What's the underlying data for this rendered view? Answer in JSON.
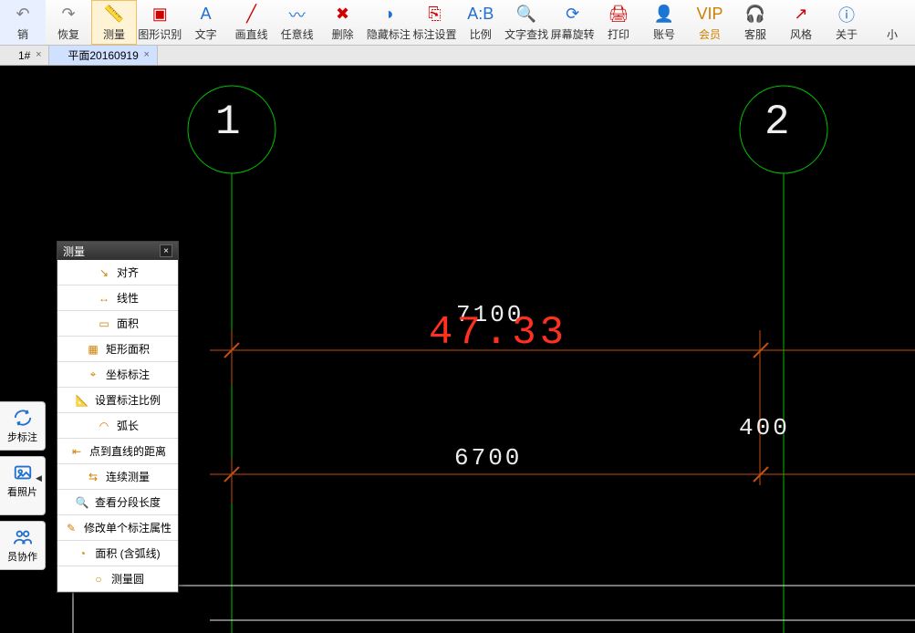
{
  "toolbar": {
    "items": [
      {
        "label": "销",
        "icon": "↶",
        "color": "#808080"
      },
      {
        "label": "恢复",
        "icon": "↷",
        "color": "#808080"
      },
      {
        "label": "测量",
        "icon": "📏",
        "color": "#2070d0",
        "active": true
      },
      {
        "label": "图形识别",
        "icon": "▣",
        "color": "#d00000"
      },
      {
        "label": "文字",
        "icon": "A",
        "color": "#2070d0"
      },
      {
        "label": "画直线",
        "icon": "╱",
        "color": "#d00000"
      },
      {
        "label": "任意线",
        "icon": "〰",
        "color": "#2070d0"
      },
      {
        "label": "删除",
        "icon": "✖",
        "color": "#d00000"
      },
      {
        "label": "隐藏标注",
        "icon": "◑",
        "color": "#2070d0"
      },
      {
        "label": "标注设置",
        "icon": "⎘",
        "color": "#d00000"
      },
      {
        "label": "比例",
        "icon": "A:B",
        "color": "#2070d0"
      },
      {
        "label": "文字查找",
        "icon": "🔍",
        "color": "#d00000"
      },
      {
        "label": "屏幕旋转",
        "icon": "⟳",
        "color": "#2070d0"
      },
      {
        "label": "打印",
        "icon": "🖨",
        "color": "#d00000"
      },
      {
        "label": "账号",
        "icon": "👤",
        "color": "#2070d0"
      },
      {
        "label": "会员",
        "icon": "VIP",
        "color": "#d08000",
        "vip": true
      },
      {
        "label": "客服",
        "icon": "🎧",
        "color": "#2070d0"
      },
      {
        "label": "风格",
        "icon": "↗",
        "color": "#d00000"
      },
      {
        "label": "关于",
        "icon": "ⓘ",
        "color": "#2070d0"
      },
      {
        "label": "小",
        "icon": "",
        "color": "#333"
      }
    ]
  },
  "tabs": {
    "items": [
      {
        "label": "1#",
        "active": false
      },
      {
        "label": "平面20160919",
        "active": true
      }
    ]
  },
  "side": {
    "items": [
      {
        "label": "步标注",
        "icon": "sync"
      },
      {
        "label": "看照片",
        "icon": "photo"
      },
      {
        "label": "员协作",
        "icon": "team"
      }
    ]
  },
  "panel": {
    "title": "测量",
    "items": [
      {
        "label": "对齐",
        "icon": "↘"
      },
      {
        "label": "线性",
        "icon": "↔"
      },
      {
        "label": "面积",
        "icon": "▭"
      },
      {
        "label": "矩形面积",
        "icon": "▦"
      },
      {
        "label": "坐标标注",
        "icon": "⌖"
      },
      {
        "label": "设置标注比例",
        "icon": "📐"
      },
      {
        "label": "弧长",
        "icon": "◠"
      },
      {
        "label": "点到直线的距离",
        "icon": "⇤"
      },
      {
        "label": "连续测量",
        "icon": "⇆"
      },
      {
        "label": "查看分段长度",
        "icon": "🔍"
      },
      {
        "label": "修改单个标注属性",
        "icon": "✎"
      },
      {
        "label": "面积 (含弧线)",
        "icon": "◔"
      },
      {
        "label": "测量圆",
        "icon": "○"
      }
    ]
  },
  "drawing": {
    "grid1": "1",
    "grid2": "2",
    "dim_top": "7100",
    "dim_mid": "47.33",
    "dim_bottom": "6700",
    "dim_right": "400"
  }
}
